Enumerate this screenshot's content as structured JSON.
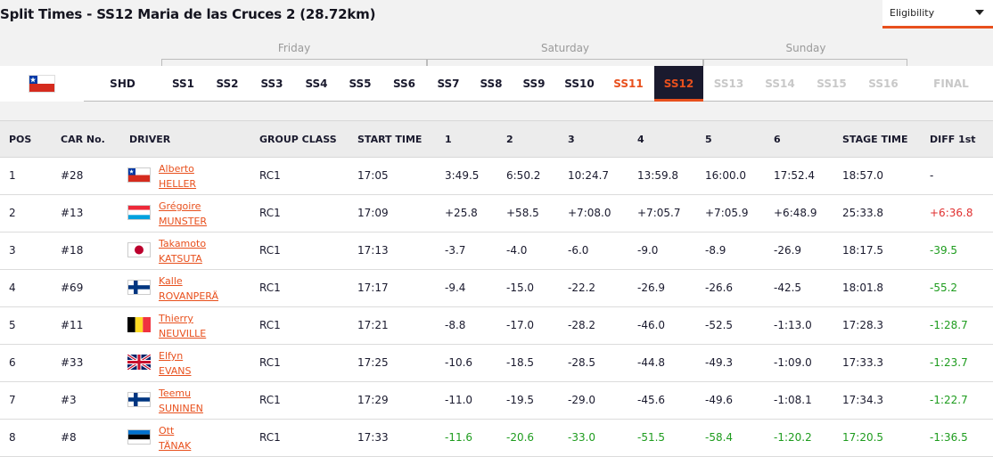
{
  "header": {
    "title": "Split Times - SS12 Maria de las Cruces 2 (28.72km)",
    "filter_label": "Eligibility"
  },
  "days": {
    "friday": "Friday",
    "saturday": "Saturday",
    "sunday": "Sunday"
  },
  "tabs": [
    {
      "label": "SHD",
      "state": "normal"
    },
    {
      "label": "SS1",
      "state": "normal"
    },
    {
      "label": "SS2",
      "state": "normal"
    },
    {
      "label": "SS3",
      "state": "normal"
    },
    {
      "label": "SS4",
      "state": "normal"
    },
    {
      "label": "SS5",
      "state": "normal"
    },
    {
      "label": "SS6",
      "state": "normal"
    },
    {
      "label": "SS7",
      "state": "normal"
    },
    {
      "label": "SS8",
      "state": "normal"
    },
    {
      "label": "SS9",
      "state": "normal"
    },
    {
      "label": "SS10",
      "state": "normal"
    },
    {
      "label": "SS11",
      "state": "done"
    },
    {
      "label": "SS12",
      "state": "active"
    },
    {
      "label": "SS13",
      "state": "future"
    },
    {
      "label": "SS14",
      "state": "future"
    },
    {
      "label": "SS15",
      "state": "future"
    },
    {
      "label": "SS16",
      "state": "future"
    },
    {
      "label": "FINAL",
      "state": "future"
    }
  ],
  "columns": {
    "pos": "POS",
    "car": "CAR No.",
    "driver": "DRIVER",
    "group": "GROUP CLASS",
    "start": "START TIME",
    "s1": "1",
    "s2": "2",
    "s3": "3",
    "s4": "4",
    "s5": "5",
    "s6": "6",
    "stage": "STAGE TIME",
    "diff": "DIFF 1st"
  },
  "rows": [
    {
      "pos": "1",
      "car": "#28",
      "first": "Alberto",
      "last": "HELLER",
      "flag": "chile",
      "group": "RC1",
      "start": "17:05",
      "s1": "3:49.5",
      "s2": "6:50.2",
      "s3": "10:24.7",
      "s4": "13:59.8",
      "s5": "16:00.0",
      "s6": "17:52.4",
      "stage": "18:57.0",
      "diff": "-"
    },
    {
      "pos": "2",
      "car": "#13",
      "first": "Grégoire",
      "last": "MUNSTER",
      "flag": "luxembourg",
      "group": "RC1",
      "start": "17:09",
      "s1": "+25.8",
      "s2": "+58.5",
      "s3": "+7:08.0",
      "s4": "+7:05.7",
      "s5": "+7:05.9",
      "s6": "+6:48.9",
      "stage": "25:33.8",
      "diff": "+6:36.8"
    },
    {
      "pos": "3",
      "car": "#18",
      "first": "Takamoto",
      "last": "KATSUTA",
      "flag": "japan",
      "group": "RC1",
      "start": "17:13",
      "s1": "-3.7",
      "s2": "-4.0",
      "s3": "-6.0",
      "s4": "-9.0",
      "s5": "-8.9",
      "s6": "-26.9",
      "stage": "18:17.5",
      "diff": "-39.5"
    },
    {
      "pos": "4",
      "car": "#69",
      "first": "Kalle",
      "last": "ROVANPERÄ",
      "flag": "finland",
      "group": "RC1",
      "start": "17:17",
      "s1": "-9.4",
      "s2": "-15.0",
      "s3": "-22.2",
      "s4": "-26.9",
      "s5": "-26.6",
      "s6": "-42.5",
      "stage": "18:01.8",
      "diff": "-55.2"
    },
    {
      "pos": "5",
      "car": "#11",
      "first": "Thierry",
      "last": "NEUVILLE",
      "flag": "belgium",
      "group": "RC1",
      "start": "17:21",
      "s1": "-8.8",
      "s2": "-17.0",
      "s3": "-28.2",
      "s4": "-46.0",
      "s5": "-52.5",
      "s6": "-1:13.0",
      "stage": "17:28.3",
      "diff": "-1:28.7"
    },
    {
      "pos": "6",
      "car": "#33",
      "first": "Elfyn",
      "last": "EVANS",
      "flag": "uk",
      "group": "RC1",
      "start": "17:25",
      "s1": "-10.6",
      "s2": "-18.5",
      "s3": "-28.5",
      "s4": "-44.8",
      "s5": "-49.3",
      "s6": "-1:09.0",
      "stage": "17:33.3",
      "diff": "-1:23.7"
    },
    {
      "pos": "7",
      "car": "#3",
      "first": "Teemu",
      "last": "SUNINEN",
      "flag": "finland",
      "group": "RC1",
      "start": "17:29",
      "s1": "-11.0",
      "s2": "-19.5",
      "s3": "-29.0",
      "s4": "-45.6",
      "s5": "-49.6",
      "s6": "-1:08.1",
      "stage": "17:34.3",
      "diff": "-1:22.7"
    },
    {
      "pos": "8",
      "car": "#8",
      "first": "Ott",
      "last": "TÄNAK",
      "flag": "estonia",
      "group": "RC1",
      "start": "17:33",
      "s1": "-11.6",
      "s2": "-20.6",
      "s3": "-33.0",
      "s4": "-51.5",
      "s5": "-58.4",
      "s6": "-1:20.2",
      "stage": "17:20.5",
      "diff": "-1:36.5",
      "fastest": true
    }
  ],
  "colors": {
    "accent": "#e8501d",
    "navy": "#1a1a2e",
    "green": "#1e9c1e",
    "red": "#e03030"
  }
}
